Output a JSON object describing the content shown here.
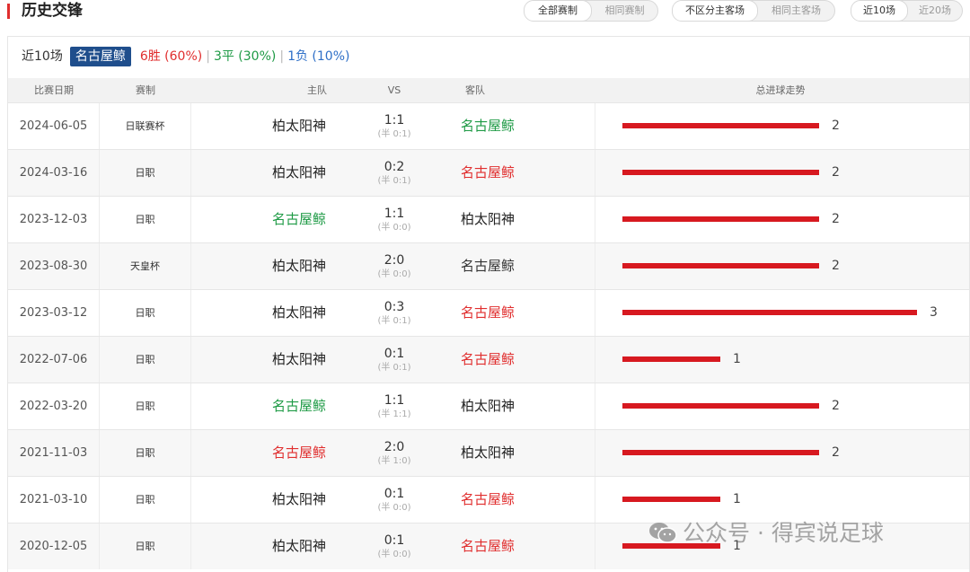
{
  "header": {
    "title": "历史交锋",
    "filter_competition": [
      "全部赛制",
      "相同赛制"
    ],
    "filter_venue": [
      "不区分主客场",
      "相同主客场"
    ],
    "filter_count": [
      "近10场",
      "近20场"
    ]
  },
  "summary": {
    "label": "近10场",
    "team": "名古屋鲸",
    "win": "6胜 (60%)",
    "draw": "3平 (30%)",
    "loss": "1负 (10%)",
    "separator": "|"
  },
  "table": {
    "headers": [
      "比赛日期",
      "赛制",
      "主队",
      "VS",
      "客队",
      "总进球走势"
    ],
    "rows": [
      {
        "date": "2024-06-05",
        "competition": "日联赛杯",
        "home": "柏太阳神",
        "score": "1:1",
        "half": "(半 0:1)",
        "away": "名古屋鲸",
        "goals": 2,
        "goals_label": "2",
        "home_color": "black",
        "away_color": "green"
      },
      {
        "date": "2024-03-16",
        "competition": "日职",
        "home": "柏太阳神",
        "score": "0:2",
        "half": "(半 0:1)",
        "away": "名古屋鲸",
        "goals": 2,
        "goals_label": "2",
        "home_color": "black",
        "away_color": "red"
      },
      {
        "date": "2023-12-03",
        "competition": "日职",
        "home": "名古屋鲸",
        "score": "1:1",
        "half": "(半 0:0)",
        "away": "柏太阳神",
        "goals": 2,
        "goals_label": "2",
        "home_color": "green",
        "away_color": "black"
      },
      {
        "date": "2023-08-30",
        "competition": "天皇杯",
        "home": "柏太阳神",
        "score": "2:0",
        "half": "(半 0:0)",
        "away": "名古屋鲸",
        "goals": 2,
        "goals_label": "2",
        "home_color": "black",
        "away_color": "blue"
      },
      {
        "date": "2023-03-12",
        "competition": "日职",
        "home": "柏太阳神",
        "score": "0:3",
        "half": "(半 0:1)",
        "away": "名古屋鲸",
        "goals": 3,
        "goals_label": "3",
        "home_color": "black",
        "away_color": "red"
      },
      {
        "date": "2022-07-06",
        "competition": "日职",
        "home": "柏太阳神",
        "score": "0:1",
        "half": "(半 0:1)",
        "away": "名古屋鲸",
        "goals": 1,
        "goals_label": "1",
        "home_color": "black",
        "away_color": "red"
      },
      {
        "date": "2022-03-20",
        "competition": "日职",
        "home": "名古屋鲸",
        "score": "1:1",
        "half": "(半 1:1)",
        "away": "柏太阳神",
        "goals": 2,
        "goals_label": "2",
        "home_color": "green",
        "away_color": "black"
      },
      {
        "date": "2021-11-03",
        "competition": "日职",
        "home": "名古屋鲸",
        "score": "2:0",
        "half": "(半 1:0)",
        "away": "柏太阳神",
        "goals": 2,
        "goals_label": "2",
        "home_color": "red",
        "away_color": "black"
      },
      {
        "date": "2021-03-10",
        "competition": "日职",
        "home": "柏太阳神",
        "score": "0:1",
        "half": "(半 0:0)",
        "away": "名古屋鲸",
        "goals": 1,
        "goals_label": "1",
        "home_color": "black",
        "away_color": "red"
      },
      {
        "date": "2020-12-05",
        "competition": "日职",
        "home": "柏太阳神",
        "score": "0:1",
        "half": "(半 0:0)",
        "away": "名古屋鲸",
        "goals": 1,
        "goals_label": "1",
        "home_color": "black",
        "away_color": "red"
      }
    ],
    "goals_max": 3
  },
  "watermark": {
    "text": "公众号 · 得宾说足球",
    "icon": "wechat-icon"
  },
  "colors": {
    "red": "#e02e2e",
    "green": "#1e9a45",
    "blue": "#2e6fc7",
    "black": "#222222",
    "bar": "#d71920",
    "badge": "#1f4e8c"
  }
}
